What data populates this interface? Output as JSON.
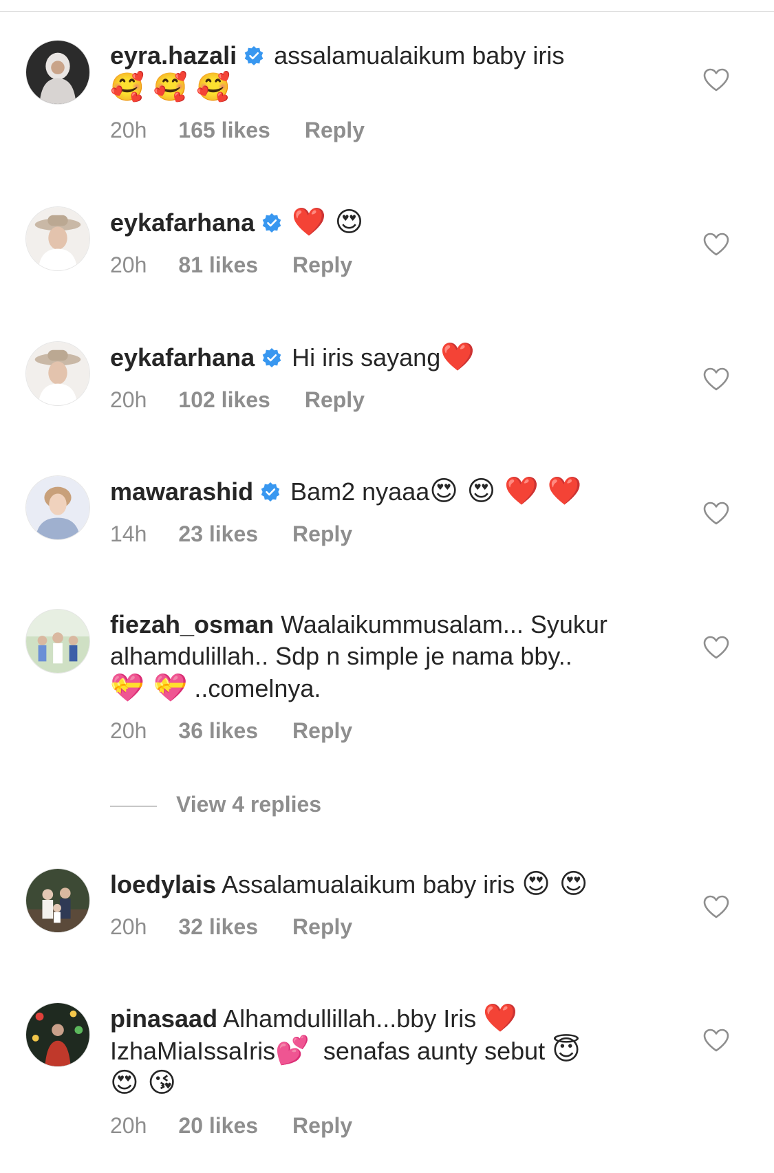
{
  "comments": [
    {
      "username": "eyra.hazali",
      "verified": true,
      "text": "assalamualaikum baby iris",
      "emoji": "🥰 🥰 🥰",
      "time": "20h",
      "likes": "165 likes",
      "reply": "Reply"
    },
    {
      "username": "eykafarhana",
      "verified": true,
      "text": "",
      "emoji": "❤️ 😍",
      "time": "20h",
      "likes": "81 likes",
      "reply": "Reply"
    },
    {
      "username": "eykafarhana",
      "verified": true,
      "text": "Hi iris sayang",
      "emoji": "❤️",
      "time": "20h",
      "likes": "102 likes",
      "reply": "Reply"
    },
    {
      "username": "mawarashid",
      "verified": true,
      "text": "Bam2 nyaaa",
      "emoji": "😍 😍 ❤️ ❤️",
      "time": "14h",
      "likes": "23 likes",
      "reply": "Reply"
    },
    {
      "username": "fiezah_osman",
      "verified": false,
      "text": "Waalaikummusalam... Syukur alhamdulillah.. Sdp n simple je nama bby..",
      "emoji": "💝 💝",
      "text_after": " ..comelnya.",
      "time": "20h",
      "likes": "36 likes",
      "reply": "Reply"
    },
    {
      "username": "loedylais",
      "verified": false,
      "text": "Assalamualaikum baby iris",
      "emoji": "😍 😍",
      "time": "20h",
      "likes": "32 likes",
      "reply": "Reply"
    },
    {
      "username": "pinasaad",
      "verified": false,
      "text": "Alhamdullillah...bby Iris",
      "emoji": "❤️",
      "text_line2": "IzhaMiaIssaIris",
      "emoji2": "💕",
      "text_line2b": "senafas aunty sebut",
      "emoji3": "😇",
      "emoji4": "😍 😘",
      "time": "20h",
      "likes": "20 likes",
      "reply": "Reply"
    }
  ],
  "view_replies": "View 4 replies",
  "icons": {
    "verified": "verified-badge-icon",
    "like": "heart-outline-icon"
  },
  "colors": {
    "verified": "#3897f0",
    "meta": "#8e8e8e",
    "text": "#262626"
  }
}
